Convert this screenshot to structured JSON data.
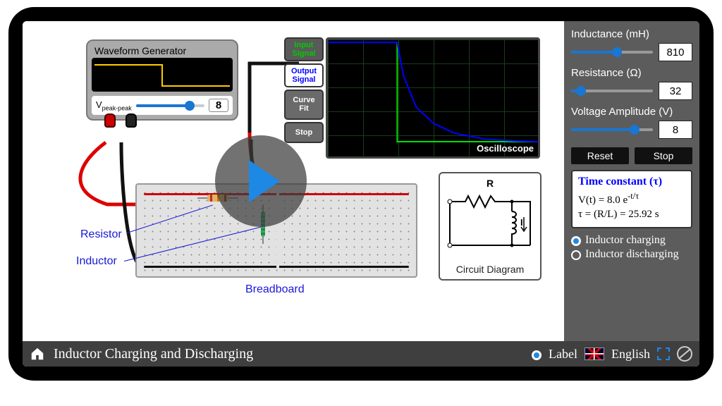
{
  "wavegen": {
    "title": "Waveform Generator",
    "vpp_label_main": "V",
    "vpp_label_sub": "peak-peak",
    "vpp_value": "8",
    "vpp_fill_pct": 78
  },
  "scope_buttons": {
    "input": "Input\nSignal",
    "output": "Output\nSignal",
    "curve_fit": "Curve\nFit",
    "stop": "Stop"
  },
  "oscilloscope_label": "Oscilloscope",
  "callouts": {
    "resistor": "Resistor",
    "inductor": "Inductor",
    "breadboard": "Breadboard"
  },
  "circuit_diagram": {
    "R": "R",
    "I": "I",
    "title": "Circuit Diagram"
  },
  "panel": {
    "inductance_label": "Inductance (mH)",
    "inductance_value": "810",
    "inductance_fill_pct": 56,
    "resistance_label": "Resistance (Ω)",
    "resistance_value": "32",
    "resistance_fill_pct": 12,
    "voltage_label": "Voltage Amplitude (V)",
    "voltage_value": "8",
    "voltage_fill_pct": 78,
    "reset": "Reset",
    "stop": "Stop",
    "tau_title": "Time constant (τ)",
    "voltage_eq_prefix": "V(t) = 8.0 e",
    "voltage_eq_sup": "-t/τ",
    "tau_eq": "τ = (R/L)  = 25.92 s",
    "radio_charging": "Inductor charging",
    "radio_discharging": "Inductor discharging"
  },
  "bottom": {
    "title": "Inductor Charging and Discharging",
    "label_toggle": "Label",
    "language": "English"
  },
  "chart_data": {
    "type": "line",
    "title": "Oscilloscope",
    "x": [
      0,
      0.1,
      0.2,
      0.3,
      0.33,
      0.33,
      0.36,
      0.42,
      0.5,
      0.6,
      0.75,
      0.9,
      1.0
    ],
    "series": [
      {
        "name": "Input Signal",
        "color": "#00e000",
        "y": [
          8,
          8,
          8,
          8,
          8,
          0,
          0,
          0,
          0,
          0,
          0,
          0,
          0
        ]
      },
      {
        "name": "Output Signal",
        "color": "#0000ff",
        "y": [
          8,
          8,
          8,
          8,
          8,
          8,
          5.3,
          2.8,
          1.5,
          0.7,
          0.2,
          0.05,
          0
        ]
      }
    ],
    "ylim": [
      0,
      8
    ],
    "xlim": [
      0,
      1
    ]
  }
}
